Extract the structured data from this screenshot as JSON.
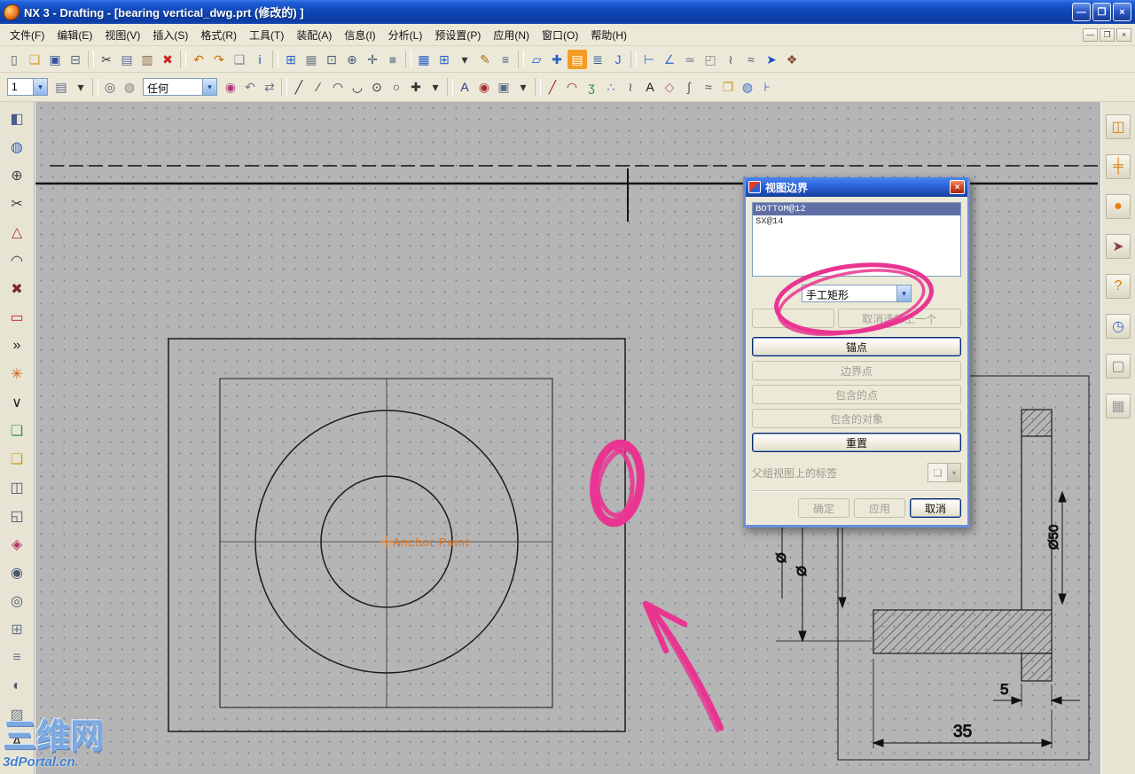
{
  "window": {
    "title": "NX 3 - Drafting - [bearing vertical_dwg.prt (修改的) ]",
    "controls": [
      {
        "name": "minimize-button",
        "glyph": "—"
      },
      {
        "name": "maximize-button",
        "glyph": "❐"
      },
      {
        "name": "close-button",
        "glyph": "×"
      }
    ]
  },
  "menubar": {
    "items": [
      {
        "name": "menu-file",
        "label": "文件(F)"
      },
      {
        "name": "menu-edit",
        "label": "编辑(E)"
      },
      {
        "name": "menu-view",
        "label": "视图(V)"
      },
      {
        "name": "menu-insert",
        "label": "插入(S)"
      },
      {
        "name": "menu-format",
        "label": "格式(R)"
      },
      {
        "name": "menu-tools",
        "label": "工具(T)"
      },
      {
        "name": "menu-assemblies",
        "label": "装配(A)"
      },
      {
        "name": "menu-information",
        "label": "信息(I)"
      },
      {
        "name": "menu-analysis",
        "label": "分析(L)"
      },
      {
        "name": "menu-preferences",
        "label": "预设置(P)"
      },
      {
        "name": "menu-application",
        "label": "应用(N)"
      },
      {
        "name": "menu-window",
        "label": "窗口(O)"
      },
      {
        "name": "menu-help",
        "label": "帮助(H)"
      }
    ],
    "mdi_controls": [
      {
        "name": "mdi-minimize-button",
        "glyph": "—"
      },
      {
        "name": "mdi-restore-button",
        "glyph": "❐"
      },
      {
        "name": "mdi-close-button",
        "glyph": "×"
      }
    ]
  },
  "toolbar1": {
    "icons": [
      {
        "name": "new-file-icon",
        "glyph": "▯",
        "color": "#58606e"
      },
      {
        "name": "open-folder-icon",
        "glyph": "❏",
        "color": "#d79b2a"
      },
      {
        "name": "save-icon",
        "glyph": "▣",
        "color": "#33539c"
      },
      {
        "name": "print-icon",
        "glyph": "⊟",
        "color": "#5a6b7a"
      },
      {
        "sep": true,
        "name": "toolbar-separator"
      },
      {
        "name": "cut-scissors-icon",
        "glyph": "✂",
        "color": "#3a3a3a"
      },
      {
        "name": "copy-icon",
        "glyph": "▤",
        "color": "#5a6b9a"
      },
      {
        "name": "paste-icon",
        "glyph": "▥",
        "color": "#8a6b4a"
      },
      {
        "name": "delete-icon",
        "glyph": "✖",
        "color": "#cc2222"
      },
      {
        "sep": true,
        "name": "toolbar-separator"
      },
      {
        "name": "undo-icon",
        "glyph": "↶",
        "color": "#d06a00"
      },
      {
        "name": "redo-icon",
        "glyph": "↷",
        "color": "#d06a00"
      },
      {
        "name": "screenshot-icon",
        "glyph": "❑",
        "color": "#7a88a0"
      },
      {
        "name": "information-icon",
        "glyph": "i",
        "color": "#1a4fd0"
      },
      {
        "sep": true,
        "name": "toolbar-separator"
      },
      {
        "name": "refresh-grid-icon",
        "glyph": "⊞",
        "color": "#2a62c8"
      },
      {
        "name": "fit-view-icon",
        "glyph": "▦",
        "color": "#7a828e"
      },
      {
        "name": "zoom-window-icon",
        "glyph": "⊡",
        "color": "#4a5a6e"
      },
      {
        "name": "zoom-icon",
        "glyph": "⊕",
        "color": "#4a5a6e"
      },
      {
        "name": "pan-icon",
        "glyph": "✛",
        "color": "#4a5a6e"
      },
      {
        "name": "shaded-display-icon",
        "glyph": "■",
        "color": "#8e9aa6"
      },
      {
        "sep": true,
        "name": "toolbar-separator"
      },
      {
        "name": "tabular-note-icon",
        "glyph": "▦",
        "color": "#2a62c8"
      },
      {
        "name": "parts-list-icon",
        "glyph": "⊞",
        "color": "#2a62c8"
      },
      {
        "name": "table-caret-icon",
        "glyph": "▾",
        "color": "#333"
      },
      {
        "name": "annotation-pencil-icon",
        "glyph": "✎",
        "color": "#b06a10"
      },
      {
        "name": "symbol-list-icon",
        "glyph": "≡",
        "color": "#44548c"
      },
      {
        "sep": true,
        "name": "toolbar-separator"
      },
      {
        "name": "datum-plane-icon",
        "glyph": "▱",
        "color": "#2a62c8"
      },
      {
        "name": "datum-axis-icon",
        "glyph": "✚",
        "color": "#2a62c8"
      },
      {
        "name": "drafting-application-icon",
        "glyph": "▤",
        "color": "#ffffff",
        "bg": "#f59a23"
      },
      {
        "name": "sheet-book-icon",
        "glyph": "≣",
        "color": "#2a5a8c"
      },
      {
        "name": "journal-icon",
        "glyph": "J",
        "color": "#2a62c8"
      },
      {
        "sep": true,
        "name": "toolbar-separator"
      },
      {
        "name": "measure-distance-icon",
        "glyph": "⊢",
        "color": "#3a76d8"
      },
      {
        "name": "measure-angle-icon",
        "glyph": "∠",
        "color": "#3a76d8"
      },
      {
        "name": "section-analysis-icon",
        "glyph": "≃",
        "color": "#7a828e"
      },
      {
        "name": "vda-checker-icon",
        "glyph": "◰",
        "color": "#8a8a8a"
      },
      {
        "name": "curve-analysis-icon",
        "glyph": "≀",
        "color": "#4a5a6e"
      },
      {
        "name": "face-analysis-icon",
        "glyph": "≈",
        "color": "#4a5a6e"
      },
      {
        "name": "datum-csys-icon",
        "glyph": "➤",
        "color": "#1a50c0"
      },
      {
        "name": "assembly-cube-icon",
        "glyph": "❖",
        "color": "#8a4a2a"
      }
    ]
  },
  "toolbar2": {
    "layer_value": "1",
    "filter_value": "任何",
    "icons_a": [
      {
        "name": "layer-settings-icon",
        "glyph": "▤",
        "color": "#5a6b8c"
      },
      {
        "name": "layer-caret-icon",
        "glyph": "▾",
        "color": "#333"
      },
      {
        "sep": true,
        "name": "toolbar-separator"
      },
      {
        "name": "wcs-target-icon",
        "glyph": "◎",
        "color": "#4a5a6e"
      },
      {
        "name": "solid-cylinder-icon",
        "glyph": "◍",
        "color": "#7a828e"
      }
    ],
    "icons_b": [
      {
        "name": "selection-ball-icon",
        "glyph": "◉",
        "color": "#b03a7a"
      },
      {
        "name": "back-view-icon",
        "glyph": "↶",
        "color": "#6a7a8a"
      },
      {
        "name": "swap-view-icon",
        "glyph": "⇄",
        "color": "#6a7a8a"
      },
      {
        "sep": true,
        "name": "toolbar-separator"
      },
      {
        "name": "line-tool-icon",
        "glyph": "╱",
        "color": "#333"
      },
      {
        "name": "inclined-line-icon",
        "glyph": "∕",
        "color": "#333"
      },
      {
        "name": "arc-tool-icon",
        "glyph": "◠",
        "color": "#333"
      },
      {
        "name": "three-point-arc-icon",
        "glyph": "◡",
        "color": "#333"
      },
      {
        "name": "circle-center-icon",
        "glyph": "⊙",
        "color": "#333"
      },
      {
        "name": "circle-tool-icon",
        "glyph": "○",
        "color": "#333"
      },
      {
        "name": "point-tool-icon",
        "glyph": "✚",
        "color": "#333"
      },
      {
        "name": "curves-caret-icon",
        "glyph": "▾",
        "color": "#333"
      },
      {
        "sep": true,
        "name": "toolbar-separator"
      },
      {
        "name": "note-text-icon",
        "glyph": "A",
        "color": "#1a3e8c"
      },
      {
        "name": "id-symbol-icon",
        "glyph": "◉",
        "color": "#a03030"
      },
      {
        "name": "custom-symbol-icon",
        "glyph": "▣",
        "color": "#5a6b8c"
      },
      {
        "name": "symbol-caret-icon",
        "glyph": "▾",
        "color": "#333"
      },
      {
        "sep": true,
        "name": "toolbar-separator"
      },
      {
        "name": "inferred-dimension-icon",
        "glyph": "╱",
        "color": "#a02020"
      },
      {
        "name": "radius-dimension-icon",
        "glyph": "◠",
        "color": "#a02020"
      },
      {
        "name": "helix-dimension-icon",
        "glyph": "ʒ",
        "color": "#2a8a2a"
      },
      {
        "name": "points-cloud-icon",
        "glyph": "∴",
        "color": "#6a4aaa"
      },
      {
        "name": "spline-icon",
        "glyph": "≀",
        "color": "#555"
      },
      {
        "name": "bold-text-icon",
        "glyph": "A",
        "color": "#111"
      },
      {
        "name": "shapes-icon",
        "glyph": "◇",
        "color": "#c2508a"
      },
      {
        "name": "section-curve-icon",
        "glyph": "∫",
        "color": "#555"
      },
      {
        "name": "wave-icon",
        "glyph": "≈",
        "color": "#555"
      },
      {
        "name": "sheet-gold-icon",
        "glyph": "❒",
        "color": "#c89a20"
      },
      {
        "name": "cylinder-blue-icon",
        "glyph": "◍",
        "color": "#3a6ac8"
      },
      {
        "name": "ruler-plus-icon",
        "glyph": "⊦",
        "color": "#3a6ac8"
      }
    ]
  },
  "left_toolbar": {
    "icons": [
      {
        "name": "edit-object-display-icon",
        "glyph": "◧",
        "color": "#4a5a8c"
      },
      {
        "name": "view-operation-icon",
        "glyph": "◍",
        "color": "#2a62c8"
      },
      {
        "name": "zoom-tool-icon",
        "glyph": "⊕",
        "color": "#444"
      },
      {
        "name": "view-break-icon",
        "glyph": "✂",
        "color": "#444"
      },
      {
        "name": "datum-triangle-icon",
        "glyph": "△",
        "color": "#a04030"
      },
      {
        "name": "fillet-tool-icon",
        "glyph": "◠",
        "color": "#444"
      },
      {
        "name": "chamfer-tool-icon",
        "glyph": "✖",
        "color": "#7a2a2a"
      },
      {
        "name": "view-boundary-tool-icon",
        "glyph": "▭",
        "color": "#c22222"
      },
      {
        "name": "more-tools-chevron-icon",
        "glyph": "»",
        "color": "#222"
      },
      {
        "name": "display-update-icon",
        "glyph": "✳",
        "color": "#d06010"
      },
      {
        "name": "expand-chevron-icon",
        "glyph": "∨",
        "color": "#222"
      },
      {
        "name": "new-sheet-icon",
        "glyph": "❏",
        "color": "#3a9a4a"
      },
      {
        "name": "open-sheet-icon",
        "glyph": "❏",
        "color": "#c8a020"
      },
      {
        "name": "base-view-icon",
        "glyph": "◫",
        "color": "#4a5a6e"
      },
      {
        "name": "projected-view-icon",
        "glyph": "◱",
        "color": "#4a5a6e"
      },
      {
        "name": "detail-view-icon",
        "glyph": "◈",
        "color": "#b03a6a"
      },
      {
        "name": "section-view-icon",
        "glyph": "◉",
        "color": "#4a5a6e"
      },
      {
        "name": "half-section-view-icon",
        "glyph": "◎",
        "color": "#4a5a6e"
      },
      {
        "name": "break-view-icon",
        "glyph": "⊞",
        "color": "#6a7a8a"
      },
      {
        "name": "view-list-icon",
        "glyph": "≡",
        "color": "#6a7a8a"
      },
      {
        "name": "section-line-icon",
        "glyph": "◐",
        "color": "#4a5a6e"
      },
      {
        "name": "crosshatch-icon",
        "glyph": "▨",
        "color": "#6a7a8a"
      },
      {
        "name": "text-annotation-icon",
        "glyph": "A",
        "color": "#222"
      }
    ]
  },
  "right_toolbar": {
    "icons": [
      {
        "name": "layout-tab-icon",
        "glyph": "◫",
        "color": "#d88010"
      },
      {
        "name": "dimension-tab-icon",
        "glyph": "╪",
        "color": "#d88010"
      },
      {
        "name": "materials-ball-icon",
        "glyph": "●",
        "color": "#e88010"
      },
      {
        "name": "roles-icon",
        "glyph": "➤",
        "color": "#8a4444"
      },
      {
        "name": "help-icon",
        "glyph": "?",
        "color": "#d88010"
      },
      {
        "name": "history-clock-icon",
        "glyph": "◷",
        "color": "#3a6ac8"
      },
      {
        "name": "palette-page-icon",
        "glyph": "▢",
        "color": "#888"
      },
      {
        "name": "web-browser-icon",
        "glyph": "▦",
        "color": "#999"
      }
    ]
  },
  "dialog": {
    "title": "视图边界",
    "list_items": [
      {
        "name": "view-list-item-bottom",
        "label": "BOTTOM@12",
        "selected": true
      },
      {
        "name": "view-list-item-sx",
        "label": "SX@14",
        "selected": false
      }
    ],
    "mode_dropdown_value": "手工矩形",
    "chain_button_label": "",
    "deselect_last_label": "取消选择上一个",
    "action_buttons": [
      {
        "name": "anchor-point-button",
        "label": "锚点",
        "enabled": true,
        "default": true
      },
      {
        "name": "boundary-point-button",
        "label": "边界点",
        "enabled": false
      },
      {
        "name": "include-point-button",
        "label": "包含的点",
        "enabled": false
      },
      {
        "name": "include-object-button",
        "label": "包含的对象",
        "enabled": false
      },
      {
        "name": "reset-button",
        "label": "重置",
        "enabled": true,
        "default": true
      }
    ],
    "parent_label": "父组视图上的标签",
    "footer_buttons": [
      {
        "name": "ok-button",
        "label": "确定",
        "enabled": false
      },
      {
        "name": "apply-button",
        "label": "应用",
        "enabled": false
      },
      {
        "name": "cancel-button",
        "label": "取消",
        "enabled": true,
        "default": true
      }
    ]
  },
  "canvas": {
    "anchor_label": "Anchor Point",
    "dimensions": {
      "dim_5": "5",
      "dim_35": "35",
      "dia_a": "Ø",
      "dia_b": "Ø",
      "dia_c": "Ø50"
    }
  },
  "watermark": {
    "line1": "三维网",
    "line2": "3dPortal.cn"
  }
}
